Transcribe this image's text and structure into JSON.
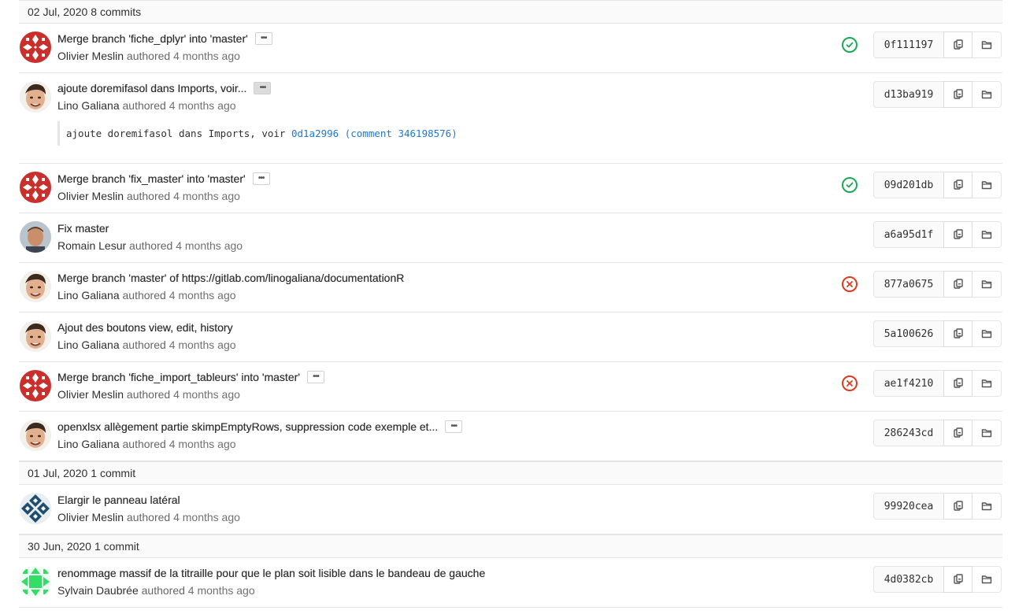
{
  "groups": [
    {
      "date": "02 Jul, 2020",
      "count": "8 commits",
      "commits": [
        {
          "title": "Merge branch 'fiche_dplyr' into 'master'",
          "author": "Olivier Meslin",
          "authored": "authored",
          "time": "4 months ago",
          "sha": "0f111197",
          "status": "success",
          "avatar": "red-pattern",
          "ellipsis": true
        },
        {
          "title": "ajoute doremifasol dans Imports, voir...",
          "author": "Lino Galiana",
          "authored": "authored",
          "time": "4 months ago",
          "sha": "d13ba919",
          "status": "",
          "avatar": "lino",
          "ellipsis": true,
          "description": {
            "text": "ajoute doremifasol dans Imports, voir ",
            "link1": "0d1a2996",
            "link2": "(comment 346198576)"
          }
        },
        {
          "title": "Merge branch 'fix_master' into 'master'",
          "author": "Olivier Meslin",
          "authored": "authored",
          "time": "4 months ago",
          "sha": "09d201db",
          "status": "success",
          "avatar": "red-pattern",
          "ellipsis": true
        },
        {
          "title": "Fix master",
          "author": "Romain Lesur",
          "authored": "authored",
          "time": "4 months ago",
          "sha": "a6a95d1f",
          "status": "",
          "avatar": "romain",
          "ellipsis": false
        },
        {
          "title": "Merge branch 'master' of https://gitlab.com/linogaliana/documentationR",
          "author": "Lino Galiana",
          "authored": "authored",
          "time": "4 months ago",
          "sha": "877a0675",
          "status": "failed",
          "avatar": "lino",
          "ellipsis": false
        },
        {
          "title": "Ajout des boutons view, edit, history",
          "author": "Lino Galiana",
          "authored": "authored",
          "time": "4 months ago",
          "sha": "5a100626",
          "status": "",
          "avatar": "lino",
          "ellipsis": false
        },
        {
          "title": "Merge branch 'fiche_import_tableurs' into 'master'",
          "author": "Olivier Meslin",
          "authored": "authored",
          "time": "4 months ago",
          "sha": "ae1f4210",
          "status": "failed",
          "avatar": "red-pattern",
          "ellipsis": true
        },
        {
          "title": "openxlsx allègement partie skimpEmptyRows, suppression code exemple et...",
          "author": "Lino Galiana",
          "authored": "authored",
          "time": "4 months ago",
          "sha": "286243cd",
          "status": "",
          "avatar": "lino",
          "ellipsis": true
        }
      ]
    },
    {
      "date": "01 Jul, 2020",
      "count": "1 commit",
      "commits": [
        {
          "title": "Elargir le panneau latéral",
          "author": "Olivier Meslin",
          "authored": "authored",
          "time": "4 months ago",
          "sha": "99920cea",
          "status": "",
          "avatar": "blue-pattern",
          "ellipsis": false
        }
      ]
    },
    {
      "date": "30 Jun, 2020",
      "count": "1 commit",
      "commits": [
        {
          "title": "renommage massif de la titraille pour que le plan soit lisible dans le bandeau de gauche",
          "author": "Sylvain Daubrée",
          "authored": "authored",
          "time": "4 months ago",
          "sha": "4d0382cb",
          "status": "",
          "avatar": "green-pattern",
          "ellipsis": false
        }
      ]
    }
  ],
  "icons": {
    "ellipsis": "•••",
    "status_success_color": "#1aaa55",
    "status_failed_color": "#db3b21",
    "link_color": "#1f78d1"
  }
}
